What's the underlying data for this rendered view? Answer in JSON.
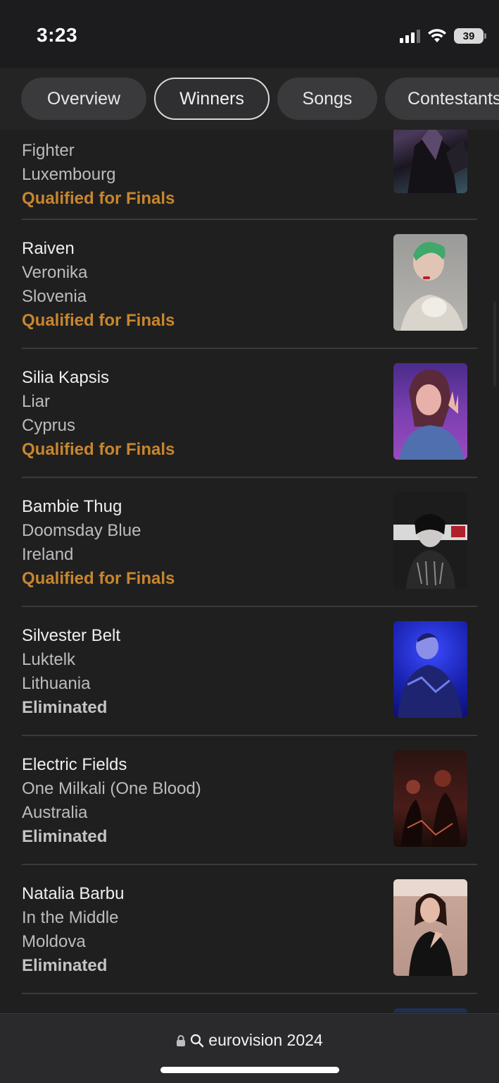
{
  "status_bar": {
    "time": "3:23",
    "battery_level": "39",
    "icons": [
      "cellular-signal-icon",
      "wifi-icon",
      "battery-icon"
    ]
  },
  "tabs": [
    {
      "label": "Overview",
      "active": false
    },
    {
      "label": "Winners",
      "active": true
    },
    {
      "label": "Songs",
      "active": false
    },
    {
      "label": "Contestants",
      "active": false
    }
  ],
  "entries": [
    {
      "artist": "",
      "song": "Fighter",
      "country": "Luxembourg",
      "status": "Qualified for Finals",
      "status_type": "qualified"
    },
    {
      "artist": "Raiven",
      "song": "Veronika",
      "country": "Slovenia",
      "status": "Qualified for Finals",
      "status_type": "qualified"
    },
    {
      "artist": "Silia Kapsis",
      "song": "Liar",
      "country": "Cyprus",
      "status": "Qualified for Finals",
      "status_type": "qualified"
    },
    {
      "artist": "Bambie Thug",
      "song": "Doomsday Blue",
      "country": "Ireland",
      "status": "Qualified for Finals",
      "status_type": "qualified"
    },
    {
      "artist": "Silvester Belt",
      "song": "Luktelk",
      "country": "Lithuania",
      "status": "Eliminated",
      "status_type": "eliminated"
    },
    {
      "artist": "Electric Fields",
      "song": "One Milkali (One Blood)",
      "country": "Australia",
      "status": "Eliminated",
      "status_type": "eliminated"
    },
    {
      "artist": "Natalia Barbu",
      "song": "In the Middle",
      "country": "Moldova",
      "status": "Eliminated",
      "status_type": "eliminated"
    }
  ],
  "browser": {
    "url_text": "eurovision 2024",
    "icons": [
      "lock-icon",
      "search-icon"
    ]
  },
  "colors": {
    "qualified": "#c8862e",
    "eliminated": "#c4c4c4",
    "background": "#1f1f1f"
  }
}
